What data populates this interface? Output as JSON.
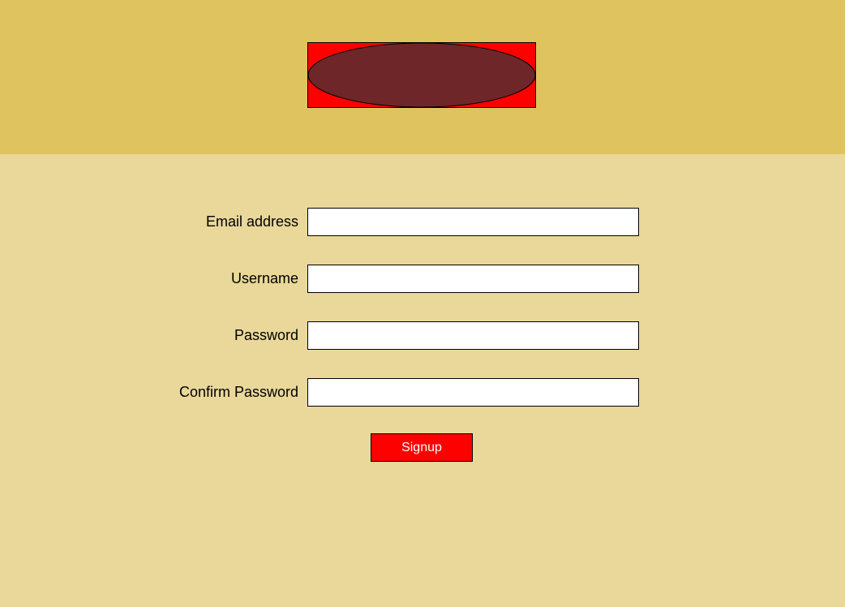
{
  "colors": {
    "header_background": "#dfc35e",
    "page_background": "#e9d89a",
    "logo_background": "#ff0000",
    "logo_ellipse": "#6e2629",
    "button_background": "#ff0000",
    "button_text": "#ffffff"
  },
  "header": {
    "logo_icon": "logo-ellipse-icon"
  },
  "form": {
    "email": {
      "label": "Email address",
      "value": "",
      "placeholder": ""
    },
    "username": {
      "label": "Username",
      "value": "",
      "placeholder": ""
    },
    "password": {
      "label": "Password",
      "value": "",
      "placeholder": ""
    },
    "confirm_password": {
      "label": "Confirm Password",
      "value": "",
      "placeholder": ""
    },
    "submit_label": "Signup"
  }
}
